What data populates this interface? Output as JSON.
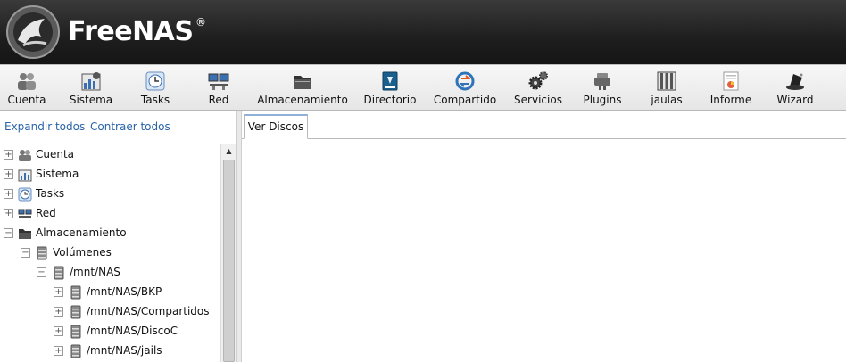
{
  "header": {
    "brand": "FreeNAS",
    "reg_mark": "®"
  },
  "toolbar": [
    {
      "label": "Cuenta",
      "icon": "users-icon"
    },
    {
      "label": "Sistema",
      "icon": "system-icon"
    },
    {
      "label": "Tasks",
      "icon": "clock-icon"
    },
    {
      "label": "Red",
      "icon": "network-icon"
    },
    {
      "label": "Almacenamiento",
      "icon": "folder-icon"
    },
    {
      "label": "Directorio",
      "icon": "directory-book-icon"
    },
    {
      "label": "Compartido",
      "icon": "share-icon"
    },
    {
      "label": "Servicios",
      "icon": "gears-icon"
    },
    {
      "label": "Plugins",
      "icon": "plugins-icon"
    },
    {
      "label": "jaulas",
      "icon": "jail-bars-icon"
    },
    {
      "label": "Informe",
      "icon": "report-icon"
    },
    {
      "label": "Wizard",
      "icon": "wizard-hat-icon"
    }
  ],
  "left": {
    "expand_all": "Expandir todos",
    "collapse_all": "Contraer todos"
  },
  "tree": [
    {
      "label": "Cuenta",
      "level": 0,
      "expander": "+",
      "icon": "users-icon"
    },
    {
      "label": "Sistema",
      "level": 0,
      "expander": "+",
      "icon": "system-icon"
    },
    {
      "label": "Tasks",
      "level": 0,
      "expander": "+",
      "icon": "clock-icon"
    },
    {
      "label": "Red",
      "level": 0,
      "expander": "+",
      "icon": "network-icon"
    },
    {
      "label": "Almacenamiento",
      "level": 0,
      "expander": "−",
      "icon": "folder-icon"
    },
    {
      "label": "Volúmenes",
      "level": 1,
      "expander": "−",
      "icon": "volume-icon"
    },
    {
      "label": "/mnt/NAS",
      "level": 2,
      "expander": "−",
      "icon": "volume-icon"
    },
    {
      "label": "/mnt/NAS/BKP",
      "level": 3,
      "expander": "+",
      "icon": "volume-icon"
    },
    {
      "label": "/mnt/NAS/Compartidos",
      "level": 3,
      "expander": "+",
      "icon": "volume-icon"
    },
    {
      "label": "/mnt/NAS/DiscoC",
      "level": 3,
      "expander": "+",
      "icon": "volume-icon"
    },
    {
      "label": "/mnt/NAS/jails",
      "level": 3,
      "expander": "+",
      "icon": "volume-icon"
    }
  ],
  "tabs": [
    {
      "label": "Ver Discos"
    }
  ]
}
